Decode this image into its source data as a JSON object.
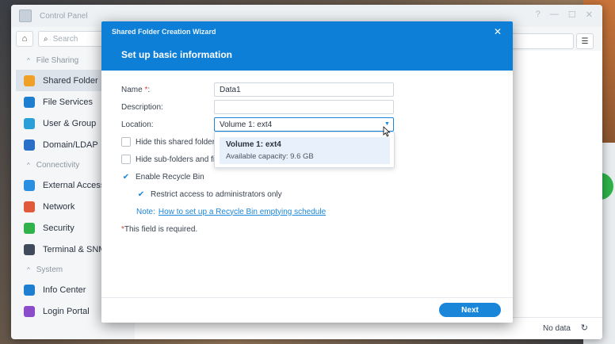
{
  "control_panel": {
    "title": "Control Panel",
    "search_placeholder": "Search",
    "no_data": "No data",
    "sections": [
      {
        "header": "File Sharing",
        "items": [
          {
            "label": "Shared Folder",
            "color": "#f0a028",
            "active": true
          },
          {
            "label": "File Services",
            "color": "#1e7fd0"
          },
          {
            "label": "User & Group",
            "color": "#2a9fd8"
          },
          {
            "label": "Domain/LDAP",
            "color": "#2a6fc8"
          }
        ]
      },
      {
        "header": "Connectivity",
        "items": [
          {
            "label": "External Access",
            "color": "#2a8fe0"
          },
          {
            "label": "Network",
            "color": "#e05a3a"
          },
          {
            "label": "Security",
            "color": "#2fb24a"
          },
          {
            "label": "Terminal & SNMP",
            "color": "#3f4b5a"
          }
        ]
      },
      {
        "header": "System",
        "items": [
          {
            "label": "Info Center",
            "color": "#1e7fd0"
          },
          {
            "label": "Login Portal",
            "color": "#8a4cc8"
          }
        ]
      }
    ]
  },
  "wizard": {
    "window_title": "Shared Folder Creation Wizard",
    "heading": "Set up basic information",
    "fields": {
      "name_label": "Name",
      "name_req": "*",
      "name_colon": ":",
      "name_value": "Data1",
      "description_label": "Description:",
      "description_value": "",
      "location_label": "Location:",
      "location_value": "Volume 1:  ext4"
    },
    "checks": {
      "hide_shared": "Hide this shared folder",
      "hide_sub": "Hide sub-folders and fil",
      "recycle_bin": "Enable Recycle Bin",
      "restrict_admin": "Restrict access to administrators only"
    },
    "note_prefix": "Note:",
    "note_link": "How to set up a Recycle Bin emptying schedule",
    "required_star": "*",
    "required_text": " This field is required.",
    "dropdown_option": {
      "name": "Volume 1: ext4",
      "capacity": "Available capacity: 9.6 GB"
    },
    "next_label": "Next"
  }
}
